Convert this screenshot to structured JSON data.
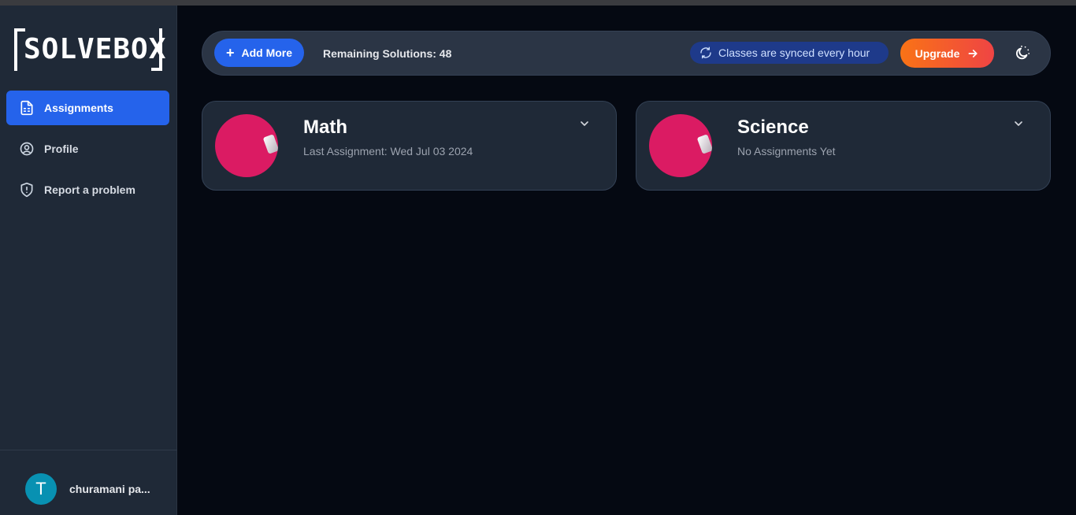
{
  "app": {
    "logo_text": "SOLVEBOX"
  },
  "sidebar": {
    "items": [
      {
        "label": "Assignments",
        "icon": "document-icon",
        "active": true
      },
      {
        "label": "Profile",
        "icon": "user-circle-icon",
        "active": false
      },
      {
        "label": "Report a problem",
        "icon": "shield-alert-icon",
        "active": false
      }
    ],
    "user": {
      "initial": "T",
      "name": "churamani pa..."
    }
  },
  "topbar": {
    "add_more_label": "Add More",
    "remaining_label": "Remaining Solutions: 48",
    "sync_label": "Classes are synced every hour",
    "upgrade_label": "Upgrade"
  },
  "classes": [
    {
      "title": "Math",
      "subtitle": "Last Assignment: Wed Jul 03 2024"
    },
    {
      "title": "Science",
      "subtitle": "No Assignments Yet"
    }
  ],
  "colors": {
    "accent": "#2563eb",
    "upgrade": "#f97316",
    "class_image": "#db1b63",
    "avatar": "#0891b2"
  }
}
